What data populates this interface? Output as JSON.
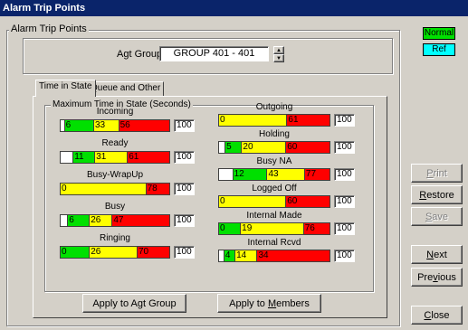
{
  "window": {
    "title": "Alarm Trip Points"
  },
  "outer_group": {
    "label": "Alarm Trip Points"
  },
  "agt_group": {
    "label": "Agt Group",
    "value": "GROUP 401 - 401"
  },
  "tabs": [
    {
      "label": "Time in State"
    },
    {
      "label": "Queue and Other"
    }
  ],
  "inner_group": {
    "label": "Maximum Time in State (Seconds)"
  },
  "metrics_left": [
    {
      "name": "Incoming",
      "max": "100",
      "segs": [
        {
          "c": "white",
          "v": "",
          "f": 0.03
        },
        {
          "c": "green",
          "v": "6",
          "f": 0.27
        },
        {
          "c": "yellow",
          "v": "33",
          "f": 0.23
        },
        {
          "c": "red",
          "v": "56",
          "f": 0.47
        }
      ]
    },
    {
      "name": "Ready",
      "max": "100",
      "segs": [
        {
          "c": "white",
          "v": "",
          "f": 0.11
        },
        {
          "c": "green",
          "v": "11",
          "f": 0.2
        },
        {
          "c": "yellow",
          "v": "31",
          "f": 0.3
        },
        {
          "c": "red",
          "v": "61",
          "f": 0.39
        }
      ]
    },
    {
      "name": "Busy-WrapUp",
      "max": "100",
      "segs": [
        {
          "c": "yellow",
          "v": "0",
          "f": 0.78
        },
        {
          "c": "red",
          "v": "78",
          "f": 0.22
        }
      ]
    },
    {
      "name": "Busy",
      "max": "100",
      "segs": [
        {
          "c": "white",
          "v": "",
          "f": 0.06
        },
        {
          "c": "green",
          "v": "6",
          "f": 0.2
        },
        {
          "c": "yellow",
          "v": "26",
          "f": 0.21
        },
        {
          "c": "red",
          "v": "47",
          "f": 0.53
        }
      ]
    },
    {
      "name": "Ringing",
      "max": "100",
      "segs": [
        {
          "c": "green",
          "v": "0",
          "f": 0.26
        },
        {
          "c": "yellow",
          "v": "26",
          "f": 0.44
        },
        {
          "c": "red",
          "v": "70",
          "f": 0.3
        }
      ]
    }
  ],
  "metrics_right": [
    {
      "name": "Outgoing",
      "max": "100",
      "segs": [
        {
          "c": "yellow",
          "v": "0",
          "f": 0.61
        },
        {
          "c": "red",
          "v": "61",
          "f": 0.39
        }
      ]
    },
    {
      "name": "Holding",
      "max": "100",
      "segs": [
        {
          "c": "white",
          "v": "",
          "f": 0.05
        },
        {
          "c": "green",
          "v": "5",
          "f": 0.15
        },
        {
          "c": "yellow",
          "v": "20",
          "f": 0.4
        },
        {
          "c": "red",
          "v": "60",
          "f": 0.4
        }
      ]
    },
    {
      "name": "Busy NA",
      "max": "100",
      "segs": [
        {
          "c": "white",
          "v": "",
          "f": 0.12
        },
        {
          "c": "green",
          "v": "12",
          "f": 0.31
        },
        {
          "c": "yellow",
          "v": "43",
          "f": 0.34
        },
        {
          "c": "red",
          "v": "77",
          "f": 0.23
        }
      ]
    },
    {
      "name": "Logged Off",
      "max": "100",
      "segs": [
        {
          "c": "yellow",
          "v": "0",
          "f": 0.6
        },
        {
          "c": "red",
          "v": "60",
          "f": 0.4
        }
      ]
    },
    {
      "name": "Internal Made",
      "max": "100",
      "segs": [
        {
          "c": "green",
          "v": "0",
          "f": 0.19
        },
        {
          "c": "yellow",
          "v": "19",
          "f": 0.57
        },
        {
          "c": "red",
          "v": "76",
          "f": 0.24
        }
      ]
    },
    {
      "name": "Internal Rcvd",
      "max": "100",
      "segs": [
        {
          "c": "white",
          "v": "",
          "f": 0.04
        },
        {
          "c": "green",
          "v": "4",
          "f": 0.1
        },
        {
          "c": "yellow",
          "v": "14",
          "f": 0.2
        },
        {
          "c": "red",
          "v": "34",
          "f": 0.66
        }
      ]
    }
  ],
  "buttons": {
    "apply_group": "Apply to Agt Group",
    "apply_members_pre": "Apply to ",
    "apply_members_acc": "M",
    "apply_members_post": "embers",
    "print_acc": "P",
    "print_rest": "rint",
    "restore_acc": "R",
    "restore_rest": "estore",
    "save_acc": "S",
    "save_rest": "ave",
    "next_acc": "N",
    "next_rest": "ext",
    "previous_pre": "Pre",
    "previous_acc": "v",
    "previous_post": "ious",
    "close_acc": "C",
    "close_rest": "lose"
  },
  "legend": {
    "normal": "Normal",
    "ref": "Ref"
  },
  "colors": {
    "green": "#00e000",
    "yellow": "#ffff00",
    "red": "#ff0000",
    "normal_bg": "#00e000",
    "ref_bg": "#00ffff",
    "title_bg": "#0a246a"
  }
}
